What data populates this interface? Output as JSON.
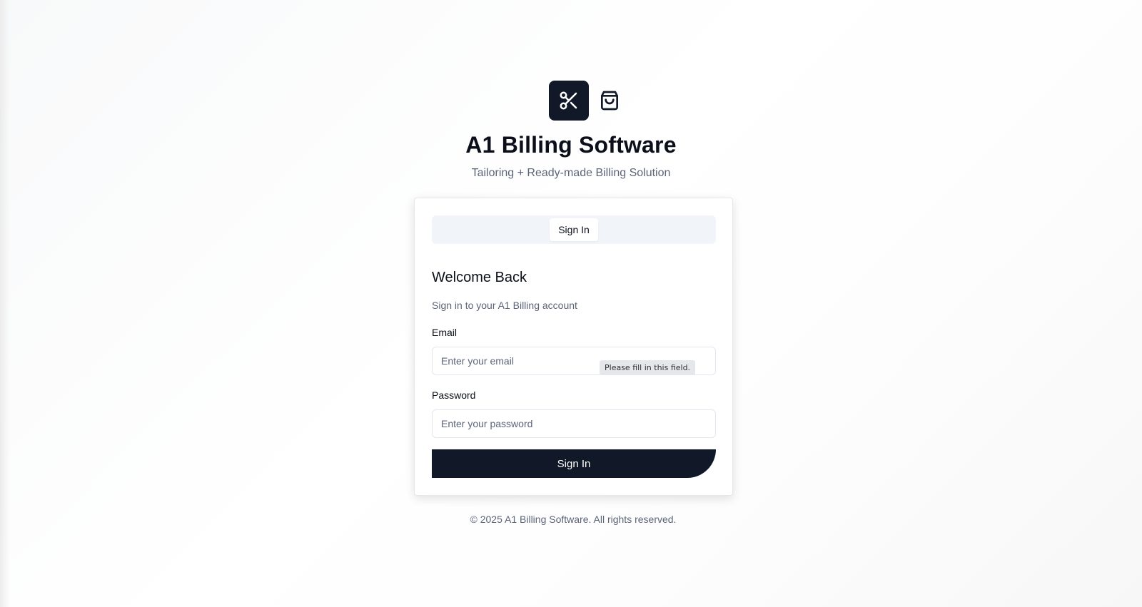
{
  "brand": {
    "logo_icon": "scissors-icon",
    "secondary_icon": "shopping-bag-icon",
    "title": "A1 Billing Software",
    "subtitle": "Tailoring + Ready-made Billing Solution"
  },
  "tabs": [
    {
      "label": "Sign In",
      "active": true
    }
  ],
  "form": {
    "heading": "Welcome Back",
    "description": "Sign in to your A1 Billing account",
    "email_label": "Email",
    "email_placeholder": "Enter your email",
    "email_value": "",
    "password_label": "Password",
    "password_placeholder": "Enter your password",
    "password_value": "",
    "validation_tooltip": "Please fill in this field.",
    "submit_label": "Sign In"
  },
  "footer": {
    "text": "© 2025 A1 Billing Software. All rights reserved."
  },
  "colors": {
    "primary": "#111827",
    "muted_text": "#5b6478",
    "tab_bg": "#f1f5f9"
  }
}
